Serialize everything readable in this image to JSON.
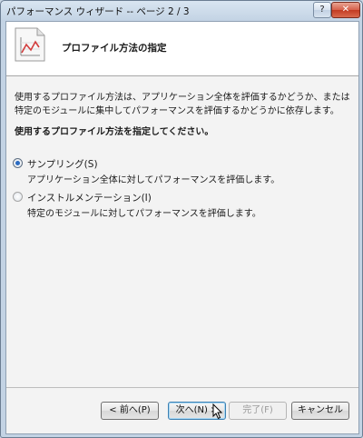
{
  "window": {
    "title": "パフォーマンス ウィザード -- ページ 2 / 3",
    "help_label": "?",
    "close_label": "✕"
  },
  "header": {
    "title": "プロファイル方法の指定",
    "icon": "chart-document-icon"
  },
  "body": {
    "description": "使用するプロファイル方法は、アプリケーション全体を評価するかどうか、または特定のモジュールに集中してパフォーマンスを評価するかどうかに依存します。",
    "instruction": "使用するプロファイル方法を指定してください。",
    "options": [
      {
        "label": "サンプリング(S)",
        "description": "アプリケーション全体に対してパフォーマンスを評価します。",
        "selected": true
      },
      {
        "label": "インストルメンテーション(I)",
        "description": "特定のモジュールに対してパフォーマンスを評価します。",
        "selected": false
      }
    ]
  },
  "buttons": {
    "back": "< 前へ(P)",
    "next": "次へ(N) >",
    "finish": "完了(F)",
    "cancel": "キャンセル"
  },
  "colors": {
    "accent": "#2a6bc2",
    "close": "#c23b22"
  }
}
